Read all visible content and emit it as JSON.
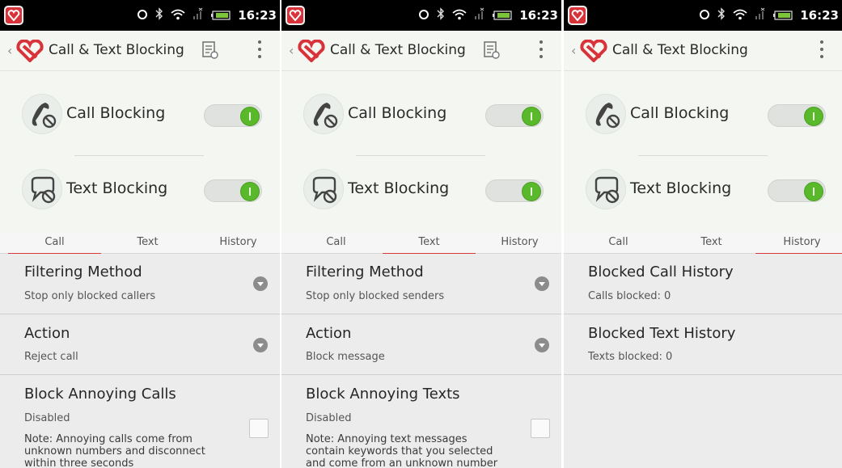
{
  "status_bar": {
    "time": "16:23"
  },
  "app": {
    "title": "Call & Text Blocking"
  },
  "toggles": {
    "call_blocking_label": "Call Blocking",
    "text_blocking_label": "Text Blocking",
    "call_blocking_on": true,
    "text_blocking_on": true
  },
  "tabs": [
    "Call",
    "Text",
    "History"
  ],
  "panels": [
    {
      "active_tab": "Call",
      "filtering": {
        "title": "Filtering Method",
        "value": "Stop only blocked callers"
      },
      "action": {
        "title": "Action",
        "value": "Reject call"
      },
      "annoying": {
        "title": "Block Annoying Calls",
        "value": "Disabled",
        "note": "Note: Annoying calls come from unknown numbers and disconnect within three seconds"
      }
    },
    {
      "active_tab": "Text",
      "filtering": {
        "title": "Filtering Method",
        "value": "Stop only blocked senders"
      },
      "action": {
        "title": "Action",
        "value": "Block message"
      },
      "annoying": {
        "title": "Block Annoying Texts",
        "value": "Disabled",
        "note": "Note: Annoying text messages contain keywords that you selected and come from an unknown number"
      }
    },
    {
      "active_tab": "History",
      "call_history": {
        "title": "Blocked Call History",
        "value": "Calls blocked: 0"
      },
      "text_history": {
        "title": "Blocked Text History",
        "value": "Texts blocked: 0"
      }
    }
  ],
  "colors": {
    "accent": "#d83a3a",
    "switch_on": "#5ab92b",
    "brand": "#d8323a"
  }
}
